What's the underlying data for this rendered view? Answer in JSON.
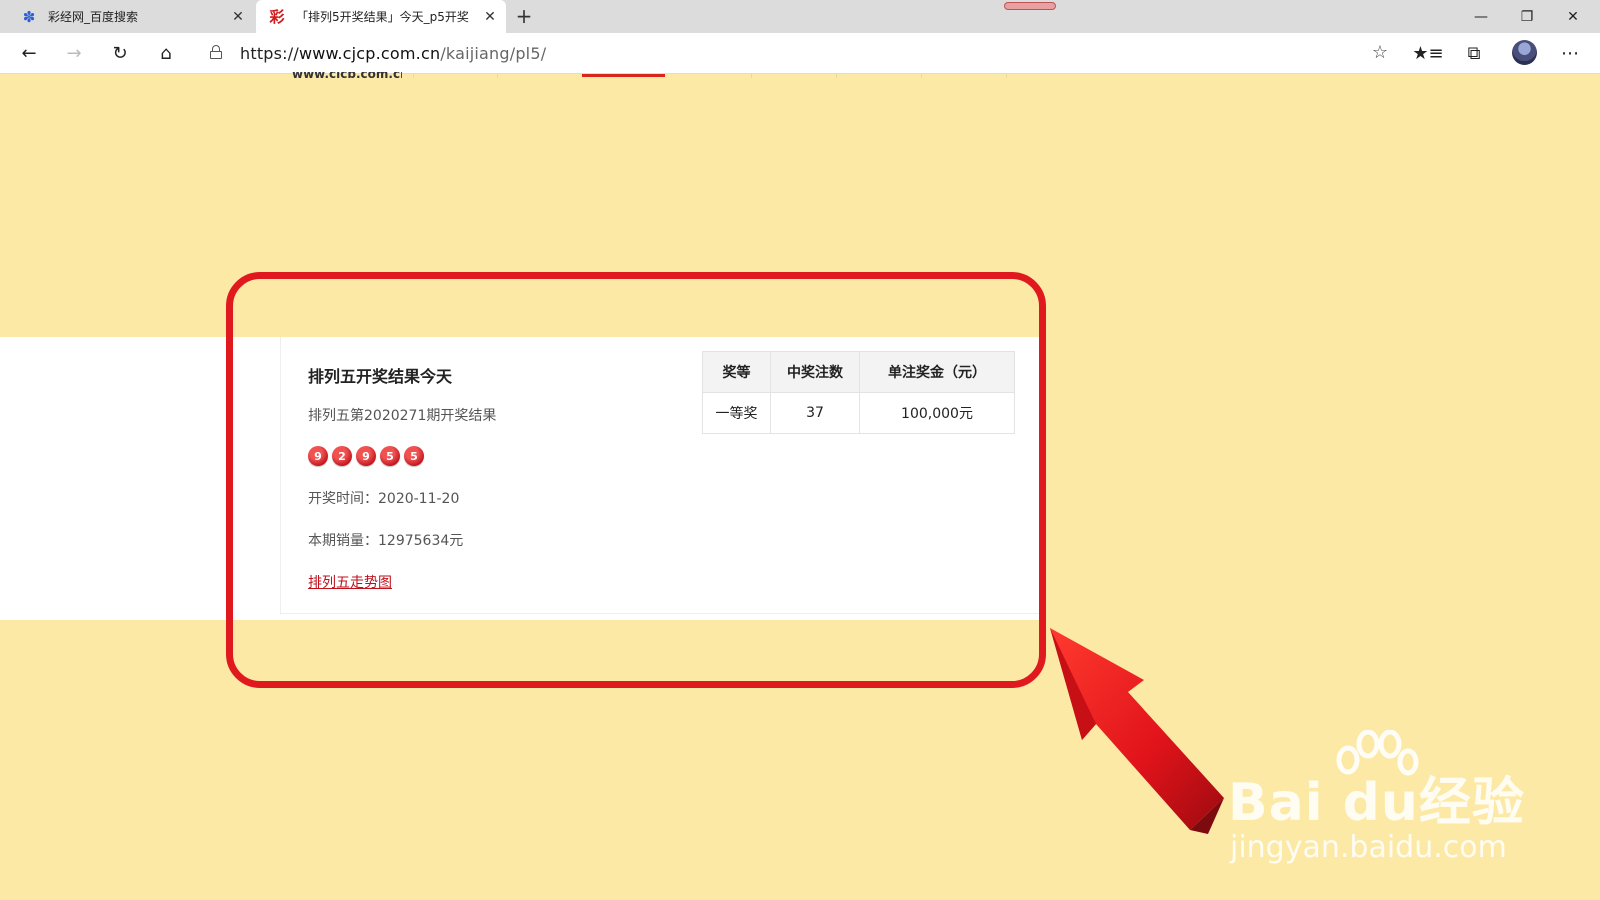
{
  "browser": {
    "tabs": [
      {
        "title": "彩经网_百度搜索",
        "icon": "baidu-paw-icon",
        "active": false
      },
      {
        "title": "「排列5开奖结果」今天_p5开奖",
        "icon": "cai-logo-icon",
        "active": true
      }
    ],
    "url": {
      "scheme": "https://",
      "host": "www.cjcp.com.cn",
      "path": "/kaijiang/pl5/"
    },
    "nav_icons": [
      "back-icon",
      "forward-icon",
      "refresh-icon",
      "home-icon",
      "lock-icon",
      "star-icon",
      "favorites-icon",
      "collections-icon",
      "profile-avatar",
      "more-icon"
    ]
  },
  "site": {
    "logo_text": "www.cjcp.com.cn"
  },
  "result": {
    "title": "排列五开奖结果今天",
    "issue": "排列五第2020271期开奖结果",
    "numbers": [
      "9",
      "2",
      "9",
      "5",
      "5"
    ],
    "draw_date_label": "开奖时间：",
    "draw_date": "2020-11-20",
    "sales_label": "本期销量：",
    "sales": "12975634元",
    "trend_link": "排列五走势图"
  },
  "prize_table": {
    "headers": [
      "奖等",
      "中奖注数",
      "单注奖金（元）"
    ],
    "rows": [
      [
        "一等奖",
        "37",
        "100,000元"
      ]
    ]
  },
  "watermark": {
    "brand": "Bai  du经验",
    "url": "jingyan.baidu.com"
  },
  "colors": {
    "page_background": "#fde9a6",
    "accent_red": "#e0191f",
    "ball_red": "#c1121c"
  }
}
